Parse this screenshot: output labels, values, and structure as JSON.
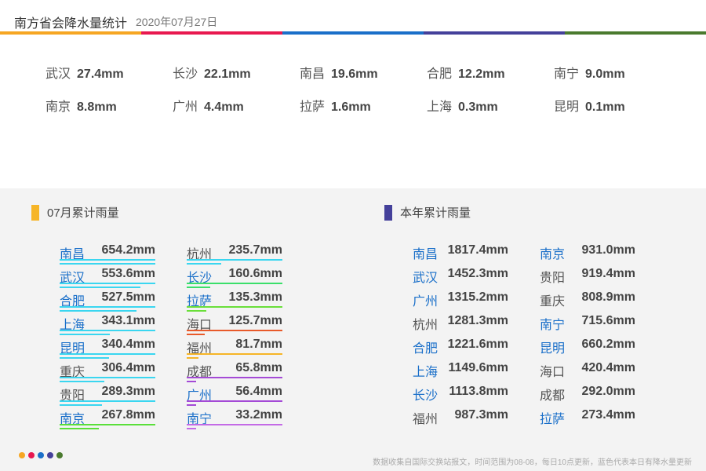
{
  "header": {
    "title": "南方省会降水量统计",
    "date": "2020年07月27日",
    "colors": [
      "#f6a623",
      "#e8184f",
      "#1a6fc9",
      "#44409a",
      "#4a7a2e"
    ]
  },
  "daily": [
    {
      "city": "武汉",
      "value": "27.4mm"
    },
    {
      "city": "长沙",
      "value": "22.1mm"
    },
    {
      "city": "南昌",
      "value": "19.6mm"
    },
    {
      "city": "合肥",
      "value": "12.2mm"
    },
    {
      "city": "南宁",
      "value": "9.0mm"
    },
    {
      "city": "南京",
      "value": "8.8mm"
    },
    {
      "city": "广州",
      "value": "4.4mm"
    },
    {
      "city": "拉萨",
      "value": "1.6mm"
    },
    {
      "city": "上海",
      "value": "0.3mm"
    },
    {
      "city": "昆明",
      "value": "0.1mm"
    }
  ],
  "monthly": {
    "title": "07月累计雨量",
    "marker_color": "#f6b527",
    "rows": [
      {
        "city": "南昌",
        "value": "654.2mm",
        "mm": 654.2,
        "highlight": true
      },
      {
        "city": "武汉",
        "value": "553.6mm",
        "mm": 553.6,
        "highlight": true
      },
      {
        "city": "合肥",
        "value": "527.5mm",
        "mm": 527.5,
        "highlight": true
      },
      {
        "city": "上海",
        "value": "343.1mm",
        "mm": 343.1,
        "highlight": true
      },
      {
        "city": "昆明",
        "value": "340.4mm",
        "mm": 340.4,
        "highlight": true
      },
      {
        "city": "重庆",
        "value": "306.4mm",
        "mm": 306.4,
        "highlight": false
      },
      {
        "city": "贵阳",
        "value": "289.3mm",
        "mm": 289.3,
        "highlight": false
      },
      {
        "city": "南京",
        "value": "267.8mm",
        "mm": 267.8,
        "highlight": true
      },
      {
        "city": "杭州",
        "value": "235.7mm",
        "mm": 235.7,
        "highlight": false
      },
      {
        "city": "长沙",
        "value": "160.6mm",
        "mm": 160.6,
        "highlight": true
      },
      {
        "city": "拉萨",
        "value": "135.3mm",
        "mm": 135.3,
        "highlight": true
      },
      {
        "city": "海口",
        "value": "125.7mm",
        "mm": 125.7,
        "highlight": false
      },
      {
        "city": "福州",
        "value": "81.7mm",
        "mm": 81.7,
        "highlight": false
      },
      {
        "city": "成都",
        "value": "65.8mm",
        "mm": 65.8,
        "highlight": false
      },
      {
        "city": "广州",
        "value": "56.4mm",
        "mm": 56.4,
        "highlight": true
      },
      {
        "city": "南宁",
        "value": "33.2mm",
        "mm": 33.2,
        "highlight": true
      }
    ]
  },
  "yearly": {
    "title": "本年累计雨量",
    "marker_color": "#44409a",
    "rows": [
      {
        "city": "南昌",
        "value": "1817.4mm",
        "highlight": true
      },
      {
        "city": "武汉",
        "value": "1452.3mm",
        "highlight": true
      },
      {
        "city": "广州",
        "value": "1315.2mm",
        "highlight": true
      },
      {
        "city": "杭州",
        "value": "1281.3mm",
        "highlight": false
      },
      {
        "city": "合肥",
        "value": "1221.6mm",
        "highlight": true
      },
      {
        "city": "上海",
        "value": "1149.6mm",
        "highlight": true
      },
      {
        "city": "长沙",
        "value": "1113.8mm",
        "highlight": true
      },
      {
        "city": "福州",
        "value": "987.3mm",
        "highlight": false
      },
      {
        "city": "南京",
        "value": "931.0mm",
        "highlight": true
      },
      {
        "city": "贵阳",
        "value": "919.4mm",
        "highlight": false
      },
      {
        "city": "重庆",
        "value": "808.9mm",
        "highlight": false
      },
      {
        "city": "南宁",
        "value": "715.6mm",
        "highlight": true
      },
      {
        "city": "昆明",
        "value": "660.2mm",
        "highlight": true
      },
      {
        "city": "海口",
        "value": "420.4mm",
        "highlight": false
      },
      {
        "city": "成都",
        "value": "292.0mm",
        "highlight": false
      },
      {
        "city": "拉萨",
        "value": "273.4mm",
        "highlight": true
      }
    ]
  },
  "highlight_color": "#1a6fc9",
  "normal_color": "#555555",
  "underline_colors": [
    "#3ad6f0",
    "#3ad6f0",
    "#3ad6f0",
    "#3ad6f0",
    "#3ad6f0",
    "#3ad6f0",
    "#3ad6f0",
    "#5adf3a",
    "#3ad6f0",
    "#3adf6a",
    "#6adf3a",
    "#e85a2a",
    "#f6b527",
    "#a44ad6",
    "#a44ad6",
    "#c46ae6"
  ],
  "footer": {
    "dots": [
      "#f6a623",
      "#e8184f",
      "#1a6fc9",
      "#44409a",
      "#4a7a2e"
    ],
    "note": "数据收集自国际交换站报文，时间范围为08-08，每日10点更新，蓝色代表本日有降水量更新"
  }
}
